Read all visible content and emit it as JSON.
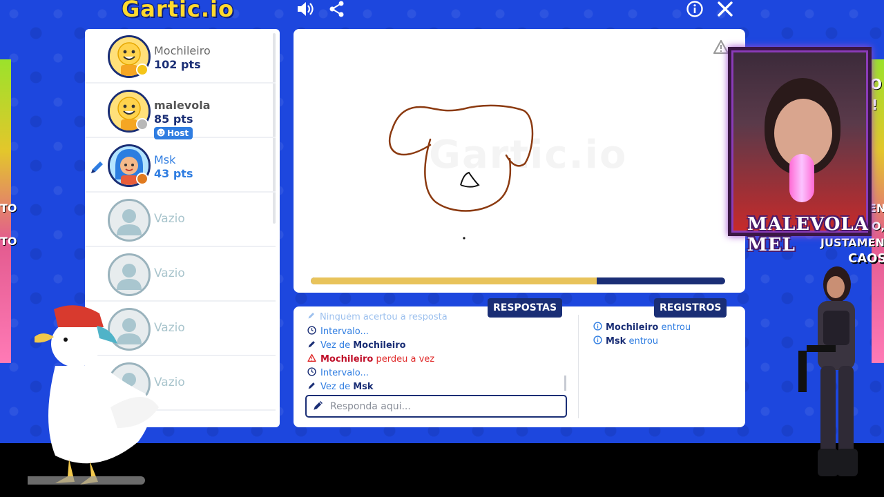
{
  "app": {
    "logo_text": "Gartic.io"
  },
  "players": [
    {
      "name": "Mochileiro",
      "points": "102 pts",
      "status_color": "#f5c518",
      "avatar": "smiley-avatar",
      "host": false,
      "drawing": false
    },
    {
      "name": "malevola",
      "points": "85 pts",
      "status_color": "#b8b8b8",
      "avatar": "smiley-avatar",
      "host": true,
      "drawing": false
    },
    {
      "name": "Msk",
      "points": "43 pts",
      "status_color": "#e07a1f",
      "avatar": "girl-avatar",
      "host": false,
      "drawing": true
    },
    {
      "name": "Vazio"
    },
    {
      "name": "Vazio"
    },
    {
      "name": "Vazio"
    },
    {
      "name": "Vazio"
    }
  ],
  "host_badge": "Host",
  "canvas": {
    "watermark": "Gartic.io",
    "progress_fraction": 0.69
  },
  "chat": {
    "answers_heading": "RESPOSTAS",
    "logs_heading": "REGISTROS",
    "answers": [
      {
        "text": "Ninguém acertou a resposta",
        "kind": "faded"
      },
      {
        "prefix": "Intervalo...",
        "kind": "clock"
      },
      {
        "prefix": "Vez de ",
        "name": "Mochileiro",
        "kind": "pencil"
      },
      {
        "name": "Mochileiro",
        "suffix": " perdeu a vez",
        "kind": "warn"
      },
      {
        "prefix": "Intervalo...",
        "kind": "clock"
      },
      {
        "prefix": "Vez de ",
        "name": "Msk",
        "kind": "pencil"
      }
    ],
    "logs": [
      {
        "name": "Mochileiro",
        "suffix": " entrou"
      },
      {
        "name": "Msk",
        "suffix": " entrou"
      }
    ],
    "answer_placeholder": "Responda aqui..."
  },
  "overlay": {
    "webcam_name": "MALEVOLA MEL",
    "side_caos": "CAOS!",
    "right_side_text_1": "ENT",
    "right_side_text_2": "O,",
    "right_side_text_3": "JUSTAMENT",
    "left_side_text_1": "TO",
    "left_side_text_2": "TO",
    "right_top_text_1": "O",
    "right_top_text_2": "!"
  },
  "colors": {
    "navy": "#1a2e75",
    "blue_bg": "#1d47de",
    "accent_blue": "#2f7de1",
    "progress": "#e8c35b",
    "brush": "#8b3a10"
  }
}
